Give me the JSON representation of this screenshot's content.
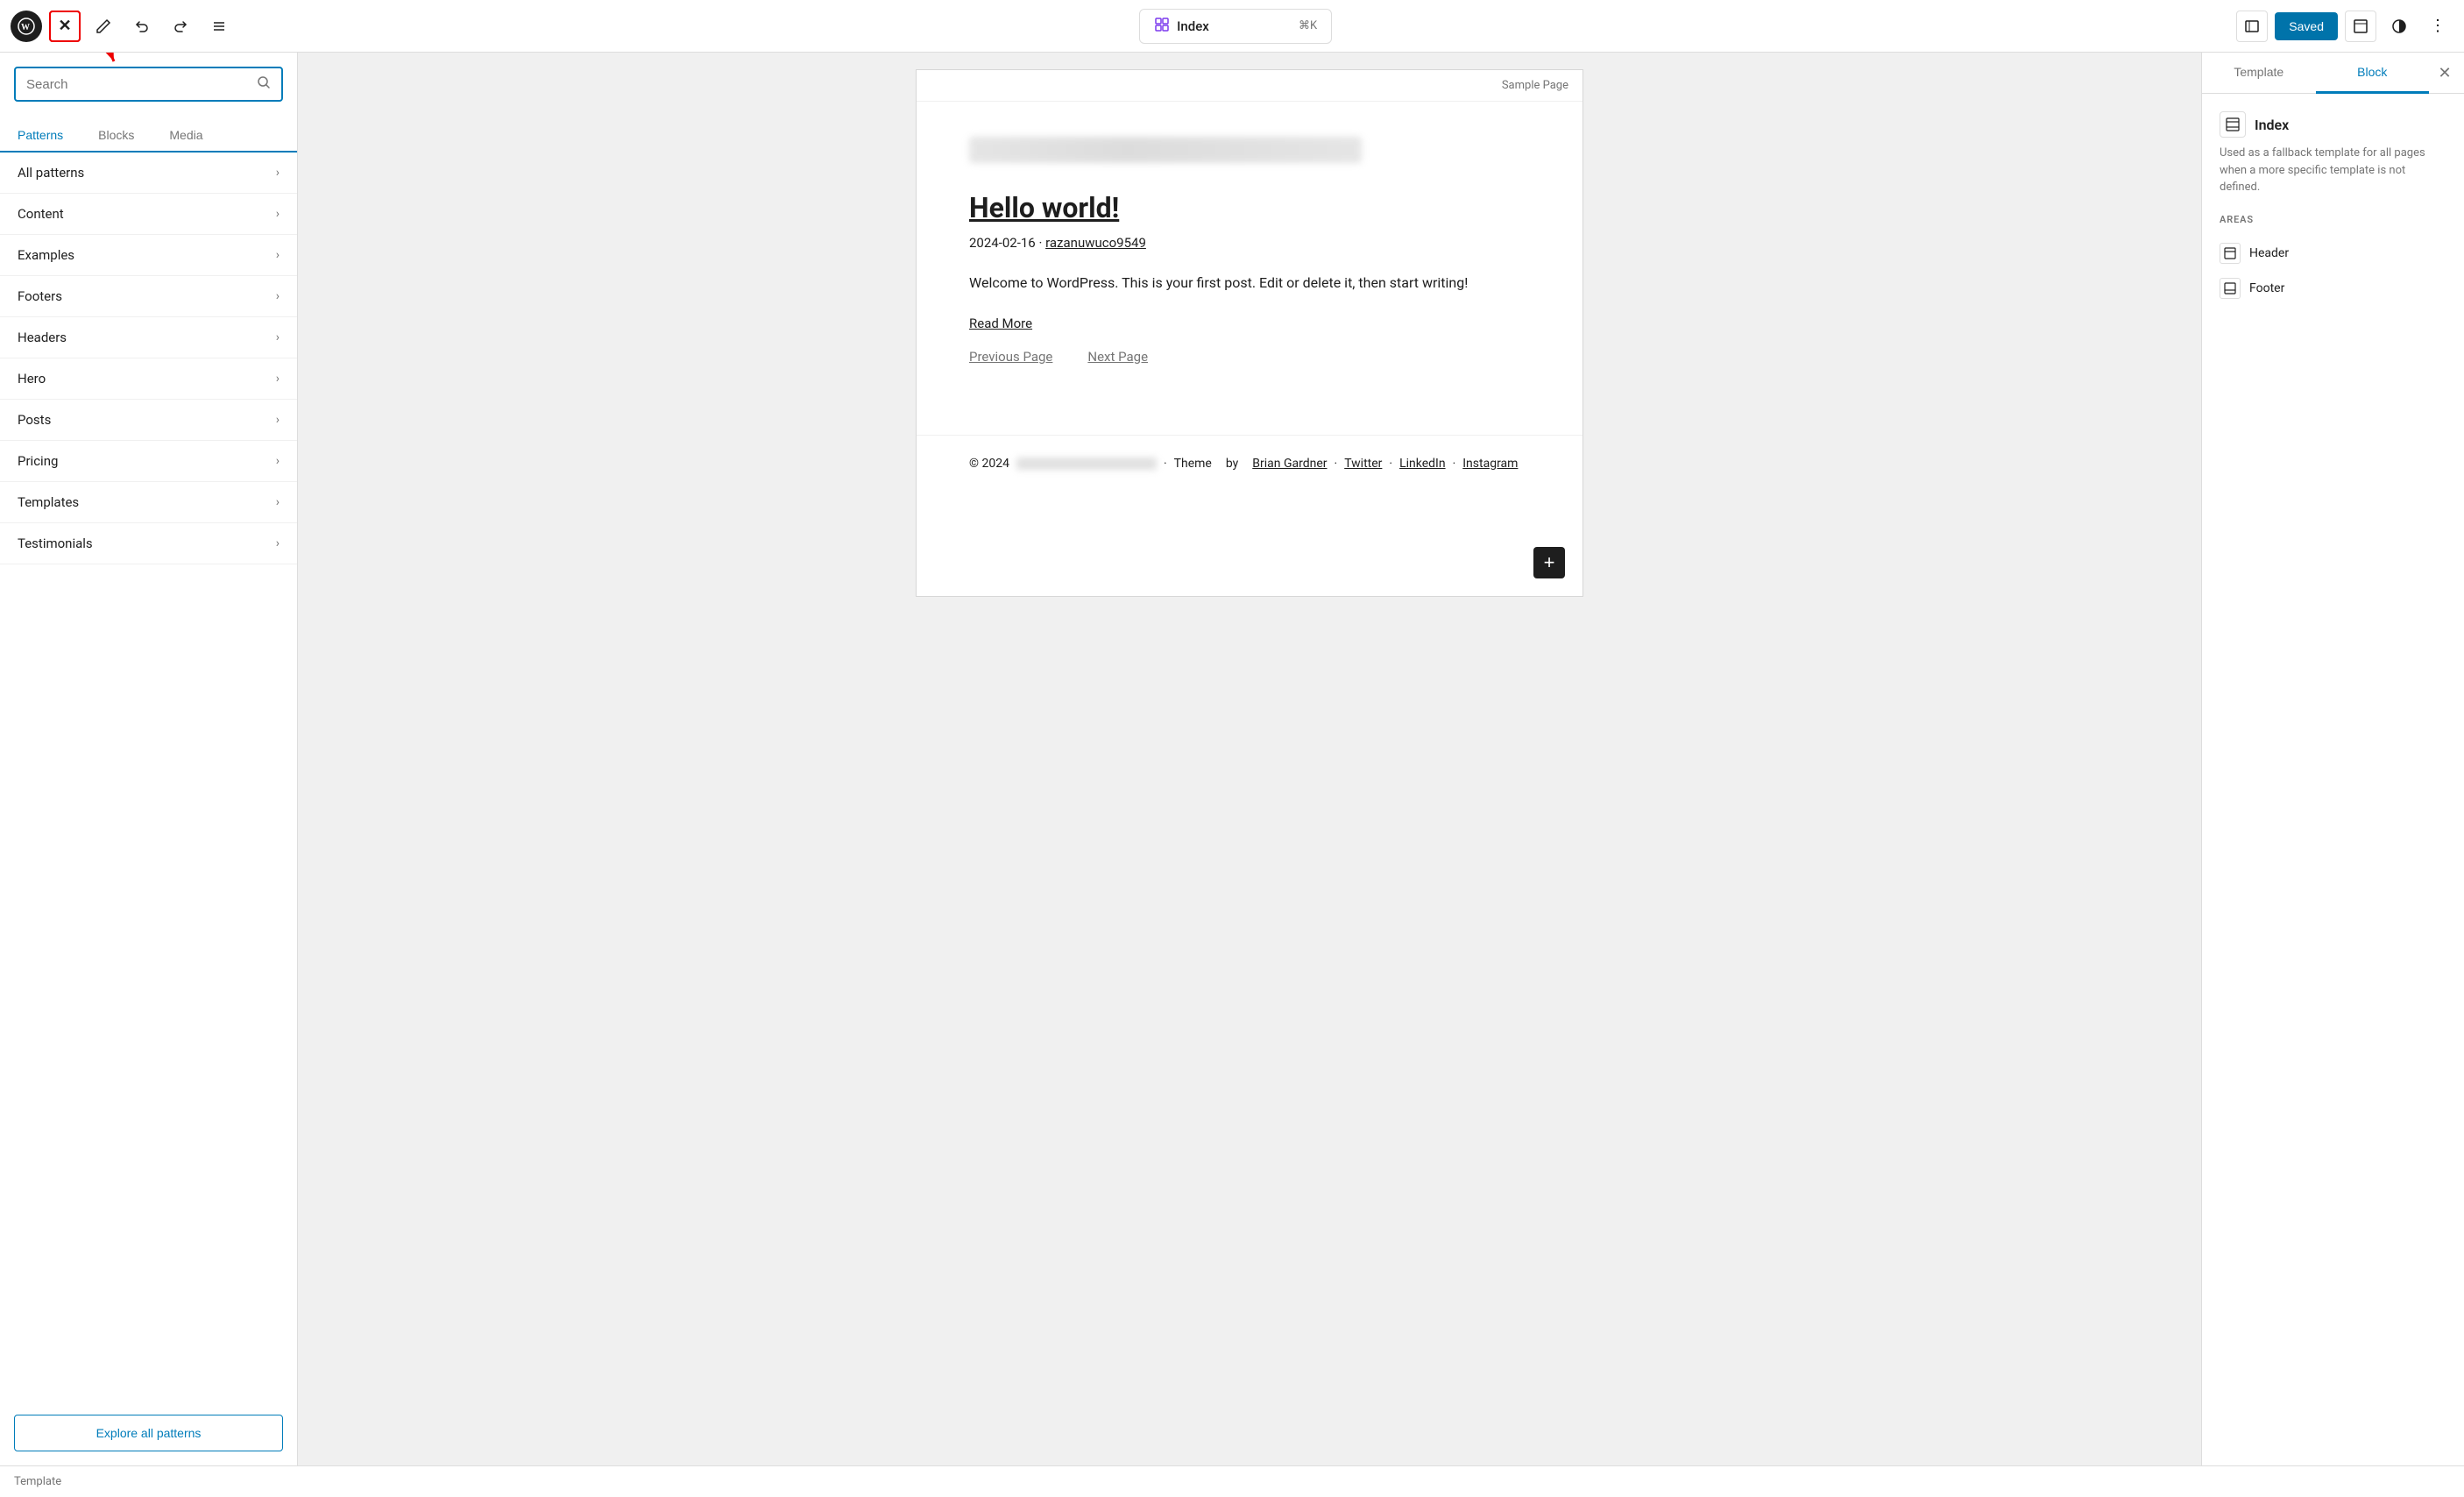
{
  "toolbar": {
    "wp_logo_alt": "WordPress logo",
    "close_label": "✕",
    "pencil_icon": "pencil",
    "undo_icon": "undo",
    "redo_icon": "redo",
    "list_view_icon": "list-view",
    "palette_icon": "palette",
    "palette_title": "Index",
    "palette_shortcut": "⌘K",
    "saved_label": "Saved",
    "view_icon": "view",
    "contrast_icon": "contrast",
    "more_icon": "⋮"
  },
  "left_sidebar": {
    "search_placeholder": "Search",
    "tabs": [
      {
        "id": "patterns",
        "label": "Patterns",
        "active": true
      },
      {
        "id": "blocks",
        "label": "Blocks",
        "active": false
      },
      {
        "id": "media",
        "label": "Media",
        "active": false
      }
    ],
    "pattern_items": [
      {
        "id": "all-patterns",
        "label": "All patterns"
      },
      {
        "id": "content",
        "label": "Content"
      },
      {
        "id": "examples",
        "label": "Examples"
      },
      {
        "id": "footers",
        "label": "Footers"
      },
      {
        "id": "headers",
        "label": "Headers"
      },
      {
        "id": "hero",
        "label": "Hero"
      },
      {
        "id": "posts",
        "label": "Posts"
      },
      {
        "id": "pricing",
        "label": "Pricing"
      },
      {
        "id": "templates",
        "label": "Templates"
      },
      {
        "id": "testimonials",
        "label": "Testimonials"
      }
    ],
    "explore_btn_label": "Explore all patterns"
  },
  "canvas": {
    "top_bar_label": "Sample Page",
    "post_title": "Hello world!",
    "post_date": "2024-02-16",
    "post_author": "razanuwuco9549",
    "post_body": "Welcome to WordPress. This is your first post. Edit or delete it, then start writing!",
    "read_more": "Read More",
    "pagination": {
      "prev": "Previous Page",
      "next": "Next Page"
    },
    "footer_year": "© 2024",
    "footer_theme": "Theme",
    "footer_by": "by",
    "footer_author": "Brian Gardner",
    "footer_twitter": "Twitter",
    "footer_linkedin": "LinkedIn",
    "footer_instagram": "Instagram",
    "add_block_label": "+"
  },
  "right_sidebar": {
    "tabs": [
      {
        "id": "template",
        "label": "Template",
        "active": false
      },
      {
        "id": "block",
        "label": "Block",
        "active": true
      }
    ],
    "close_label": "✕",
    "template_icon": "layout",
    "template_name": "Index",
    "template_desc": "Used as a fallback template for all pages when a more specific template is not defined.",
    "areas_label": "AREAS",
    "areas": [
      {
        "id": "header",
        "label": "Header"
      },
      {
        "id": "footer",
        "label": "Footer"
      }
    ]
  },
  "bottom_bar": {
    "label": "Template"
  }
}
